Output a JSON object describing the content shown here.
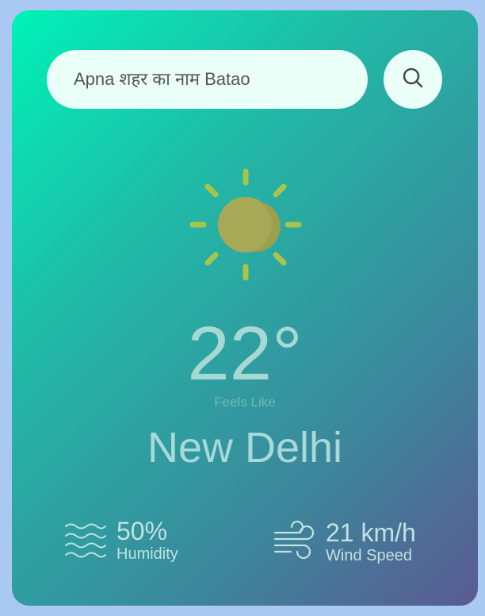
{
  "search": {
    "placeholder": "Apna शहर का नाम Batao",
    "button_icon": "search-icon"
  },
  "weather": {
    "icon": "sun-icon",
    "temperature": "22°",
    "feels_like_label": "Feels Like",
    "city": "New Delhi"
  },
  "stats": {
    "humidity": {
      "icon": "humidity-icon",
      "value": "50%",
      "label": "Humidity"
    },
    "wind": {
      "icon": "wind-icon",
      "value": "21 km/h",
      "label": "Wind Speed"
    }
  },
  "colors": {
    "gradient_start": "#00f2b8",
    "gradient_end": "#5a5a92",
    "search_bg": "#ebfff9",
    "sun": "#b3b04f",
    "sun_rays": "#a9c44a"
  }
}
